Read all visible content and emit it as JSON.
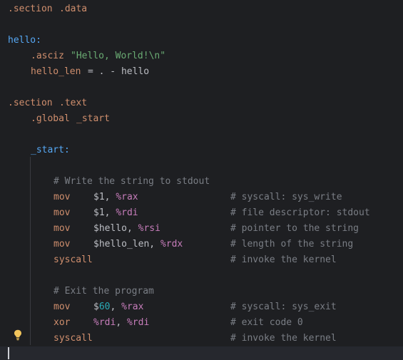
{
  "colors": {
    "background": "#1e1f22",
    "current_line": "#26282e",
    "directive": "#cf8e6d",
    "label": "#56a8f5",
    "string": "#6aab73",
    "register": "#c77dbb",
    "number": "#2aacb8",
    "comment": "#7a7e85",
    "text": "#bcbec4"
  },
  "code": {
    "l1": {
      "a": ".section",
      "b": ".data"
    },
    "l3": {
      "a": "hello:"
    },
    "l4": {
      "a": ".asciz",
      "b": "\"Hello, World!\\n\""
    },
    "l5": {
      "a": "hello_len",
      "b": "= . - hello"
    },
    "l7": {
      "a": ".section",
      "b": ".text"
    },
    "l8": {
      "a": ".global",
      "b": "_start"
    },
    "l10": {
      "a": "_start:"
    },
    "l12": {
      "a": "# Write the string to stdout"
    },
    "l13": {
      "op": "mov",
      "x1": "$1",
      "sep": ", ",
      "reg": "%rax",
      "comment": "# syscall: sys_write"
    },
    "l14": {
      "op": "mov",
      "x1": "$1",
      "sep": ", ",
      "reg": "%rdi",
      "comment": "# file descriptor: stdout"
    },
    "l15": {
      "op": "mov",
      "x1": "$hello",
      "sep": ", ",
      "reg": "%rsi",
      "comment": "# pointer to the string"
    },
    "l16": {
      "op": "mov",
      "x1": "$hello_len",
      "sep": ", ",
      "reg": "%rdx",
      "comment": "# length of the string"
    },
    "l17": {
      "op": "syscall",
      "comment": "# invoke the kernel"
    },
    "l19": {
      "a": "# Exit the program"
    },
    "l20": {
      "op": "mov",
      "x1": "$",
      "num": "60",
      "sep": ", ",
      "reg": "%rax",
      "comment": "# syscall: sys_exit"
    },
    "l21": {
      "op": "xor",
      "reg1": "%rdi",
      "sep": ", ",
      "reg": "%rdi",
      "comment": "# exit code 0"
    },
    "l22": {
      "op": "syscall",
      "comment": "# invoke the kernel"
    }
  },
  "gutter": {
    "icon": "lightbulb-icon"
  }
}
